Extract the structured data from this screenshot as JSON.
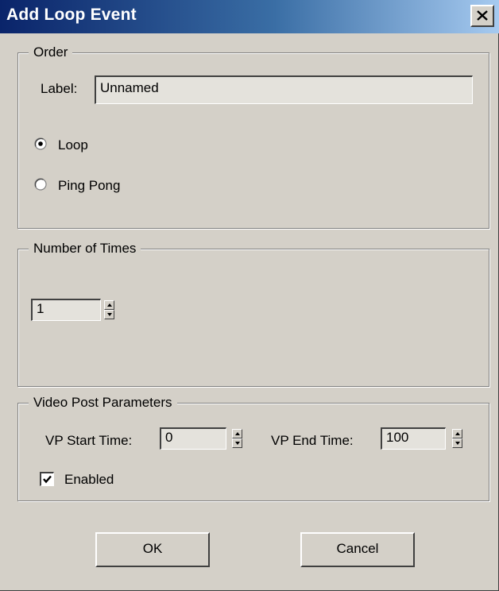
{
  "window": {
    "title": "Add Loop Event",
    "close_icon": "close-icon"
  },
  "order": {
    "group_title": "Order",
    "label_caption": "Label:",
    "label_value": "Unnamed",
    "options": [
      {
        "label": "Loop",
        "selected": true
      },
      {
        "label": "Ping Pong",
        "selected": false
      }
    ]
  },
  "number_of_times": {
    "group_title": "Number of Times",
    "value": "1"
  },
  "video_post": {
    "group_title": "Video Post Parameters",
    "start_caption": "VP Start Time:",
    "start_value": "0",
    "end_caption": "VP End Time:",
    "end_value": "100",
    "enabled_label": "Enabled",
    "enabled_checked": true
  },
  "buttons": {
    "ok_label": "OK",
    "cancel_label": "Cancel"
  },
  "colors": {
    "title_bar_start": "#0a246a",
    "title_bar_end": "#a6caf0",
    "dialog_face": "#d4d0c8"
  }
}
